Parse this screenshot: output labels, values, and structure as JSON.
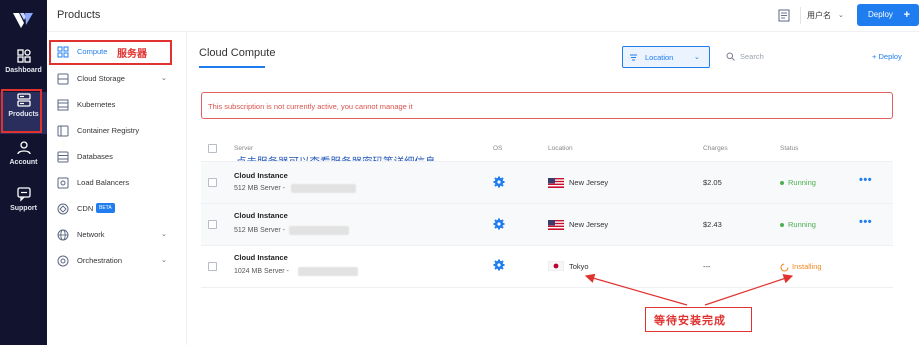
{
  "topbar": {
    "title": "Products",
    "user_label": "用户名",
    "deploy_label": "Deploy",
    "deploy_plus": "+"
  },
  "rail": {
    "items": [
      {
        "label": "Dashboard"
      },
      {
        "label": "Products"
      },
      {
        "label": "Account"
      },
      {
        "label": "Support"
      }
    ]
  },
  "subnav": {
    "items": [
      {
        "label": "Compute"
      },
      {
        "label": "Cloud Storage"
      },
      {
        "label": "Kubernetes"
      },
      {
        "label": "Container Registry"
      },
      {
        "label": "Databases"
      },
      {
        "label": "Load Balancers"
      },
      {
        "label": "CDN"
      },
      {
        "label": "Network"
      },
      {
        "label": "Orchestration"
      }
    ],
    "cdn_badge": "BETA"
  },
  "main": {
    "title": "Cloud Compute",
    "location_select": "Location",
    "search_placeholder": "Search",
    "deploy_link_plus": "+",
    "deploy_link": "Deploy",
    "alert": "This subscription is not currently active, you cannot manage it",
    "table": {
      "headers": {
        "server": "Server",
        "os": "OS",
        "location": "Location",
        "charges": "Charges",
        "status": "Status"
      },
      "rows": [
        {
          "name": "Cloud Instance",
          "sub": "512 MB Server -",
          "location": "New Jersey",
          "charges": "$2.05",
          "status": "Running"
        },
        {
          "name": "Cloud Instance",
          "sub": "512 MB Server -",
          "location": "New Jersey",
          "charges": "$2.43",
          "status": "Running"
        },
        {
          "name": "Cloud Instance",
          "sub": "1024 MB Server -",
          "location": "Tokyo",
          "charges": "---",
          "status": "Installing"
        }
      ],
      "more": "•••"
    }
  },
  "annotations": {
    "compute_cn": "服务器",
    "click_hint": "点击服务器可以查看服务器密码等详细信息",
    "wait_install": "等待安装完成"
  },
  "colors": {
    "accent": "#1f7df0",
    "rail_bg": "#12142f",
    "running": "#4caf50",
    "installing": "#f08a24",
    "annotation_red": "#e0322f"
  }
}
